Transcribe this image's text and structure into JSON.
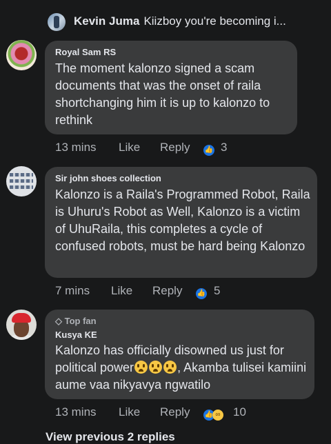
{
  "top_reply": {
    "author": "Kevin Juma",
    "text": "Kiizboy you're becoming i..."
  },
  "comments": [
    {
      "author": "Royal Sam RS",
      "badge": "",
      "text": "The moment kalonzo signed a scam documents that was the onset of raila shortchanging him it is up to kalonzo to rethink",
      "time": "13 mins",
      "like_label": "Like",
      "reply_label": "Reply",
      "reactions": [
        "like-icon"
      ],
      "reaction_count": "3"
    },
    {
      "author": "Sir john shoes collection",
      "badge": "",
      "text": "Kalonzo is a Raila's Programmed Robot, Raila is Uhuru's Robot as Well, Kalonzo is a victim of UhuRaila, this completes a cycle of confused robots, must be hard being Kalonzo",
      "time": "7 mins",
      "like_label": "Like",
      "reply_label": "Reply",
      "reactions": [
        "like-icon"
      ],
      "reaction_count": "5"
    },
    {
      "author": "Kusya KE",
      "badge": "Top fan",
      "text_before": "Kalonzo has officially disowned us just for political power",
      "text_after": ", Akamba tulisei kamiini aume vaa nikyavya ngwatilo",
      "emoji_name": "crying-face-emoji",
      "emoji_count": 3,
      "time": "13 mins",
      "like_label": "Like",
      "reply_label": "Reply",
      "reactions": [
        "like-icon",
        "haha-icon"
      ],
      "reaction_count": "10"
    }
  ],
  "view_previous": "View previous 2 replies",
  "colors": {
    "background": "#18191a",
    "bubble": "#3a3b3c",
    "text": "#e4e6eb",
    "secondary_text": "#b0b3b8",
    "like_blue": "#1b74e4"
  }
}
